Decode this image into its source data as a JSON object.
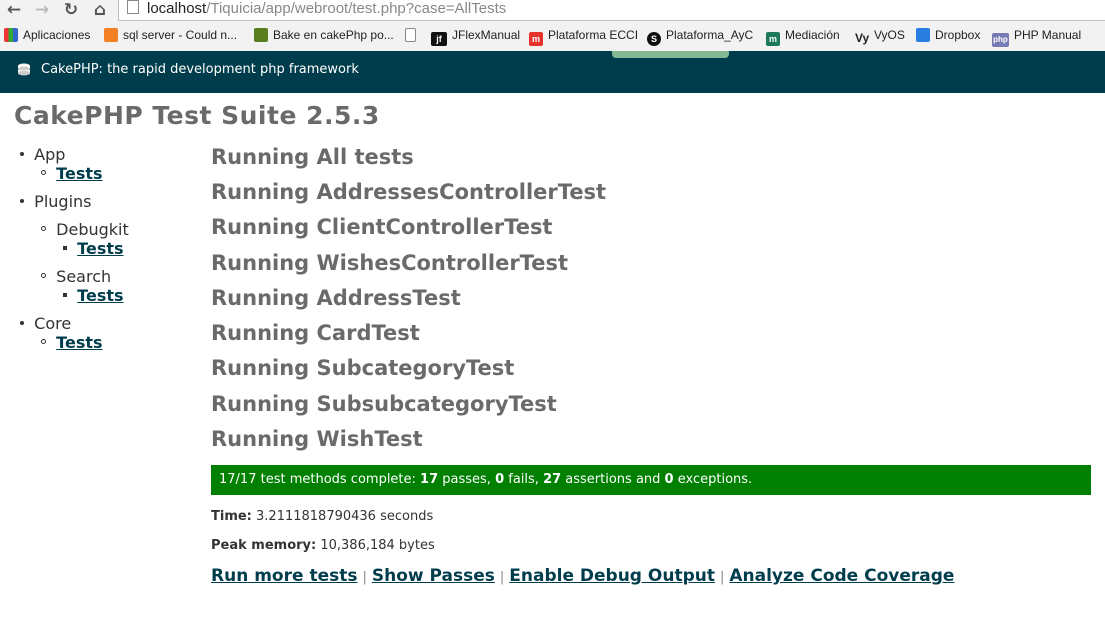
{
  "browser": {
    "url_host": "localhost",
    "url_path": "/Tiquicia/app/webroot/test.php?case=AllTests",
    "bookmarks": [
      {
        "label": "Aplicaciones",
        "icon": "apps-grid-icon"
      },
      {
        "label": "sql server - Could n...",
        "icon": "stackoverflow-icon"
      },
      {
        "label": "Bake en cakePhp po...",
        "icon": "cake-icon"
      },
      {
        "label": "",
        "icon": "page-icon"
      },
      {
        "label": "JFlexManual",
        "icon": "jflex-icon"
      },
      {
        "label": "Plataforma ECCI",
        "icon": "moodle-icon"
      },
      {
        "label": "Plataforma_AyC",
        "icon": "s-circle-icon"
      },
      {
        "label": "Mediación",
        "icon": "moodle-m-icon"
      },
      {
        "label": "VyOS",
        "icon": "vyos-icon"
      },
      {
        "label": "Dropbox",
        "icon": "dropbox-icon"
      },
      {
        "label": "PHP Manual",
        "icon": "php-icon"
      }
    ]
  },
  "header": {
    "title": "CakePHP: the rapid development php framework"
  },
  "suite_title": "CakePHP Test Suite 2.5.3",
  "sidebar": {
    "app": {
      "label": "App",
      "tests": "Tests"
    },
    "plugins": {
      "label": "Plugins",
      "debugkit": {
        "label": "Debugkit",
        "tests": "Tests"
      },
      "search": {
        "label": "Search",
        "tests": "Tests"
      }
    },
    "core": {
      "label": "Core",
      "tests": "Tests"
    }
  },
  "running": [
    "Running All tests",
    "Running AddressesControllerTest",
    "Running ClientControllerTest",
    "Running WishesControllerTest",
    "Running AddressTest",
    "Running CardTest",
    "Running SubcategoryTest",
    "Running SubsubcategoryTest",
    "Running WishTest"
  ],
  "result": {
    "prefix": "17/17 test methods complete: ",
    "passes": "17",
    "passes_label": " passes, ",
    "fails": "0",
    "fails_label": " fails, ",
    "assertions": "27",
    "assertions_label": " assertions and ",
    "exceptions": "0",
    "exceptions_label": " exceptions.",
    "color": "#008000"
  },
  "stats": {
    "time_label": "Time:",
    "time_value": " 3.2111818790436 seconds",
    "memory_label": "Peak memory:",
    "memory_value": " 10,386,184 bytes"
  },
  "links": {
    "run_more": "Run more tests",
    "show_passes": "Show Passes",
    "debug": "Enable Debug Output",
    "coverage": "Analyze Code Coverage",
    "separator": "|"
  },
  "colors": {
    "header_bg": "#003d4c",
    "link": "#003d4c",
    "title_gray": "#6a6a6a"
  }
}
